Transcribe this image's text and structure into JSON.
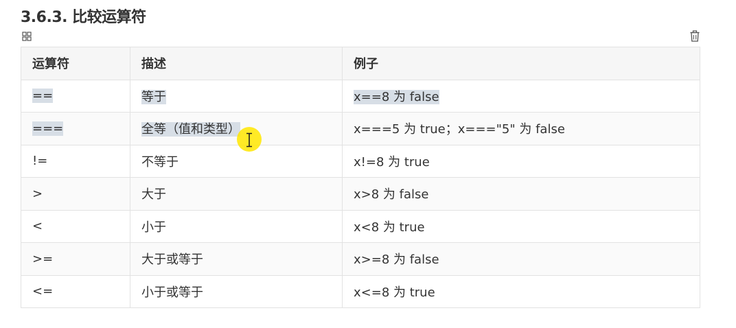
{
  "heading": "3.6.3. 比较运算符",
  "icons": {
    "grid": "grid-icon",
    "trash": "trash-icon",
    "cursor": "text-cursor-icon"
  },
  "table": {
    "headers": [
      "运算符",
      "描述",
      "例子"
    ],
    "rows": [
      {
        "op": "==",
        "desc": "等于",
        "example": "x==8 为 false"
      },
      {
        "op": "===",
        "desc": "全等（值和类型）",
        "example": "x===5 为 true；x===\"5\" 为 false"
      },
      {
        "op": "!=",
        "desc": "不等于",
        "example": "x!=8 为 true"
      },
      {
        "op": ">",
        "desc": "大于",
        "example": "x>8 为 false"
      },
      {
        "op": "<",
        "desc": "小于",
        "example": "x<8 为 true"
      },
      {
        "op": ">=",
        "desc": "大于或等于",
        "example": "x>=8 为 false"
      },
      {
        "op": "<=",
        "desc": "小于或等于",
        "example": "x<=8 为 true"
      }
    ]
  },
  "colors": {
    "selection": "#d7dee6",
    "cursor_highlight": "#ffe600"
  }
}
